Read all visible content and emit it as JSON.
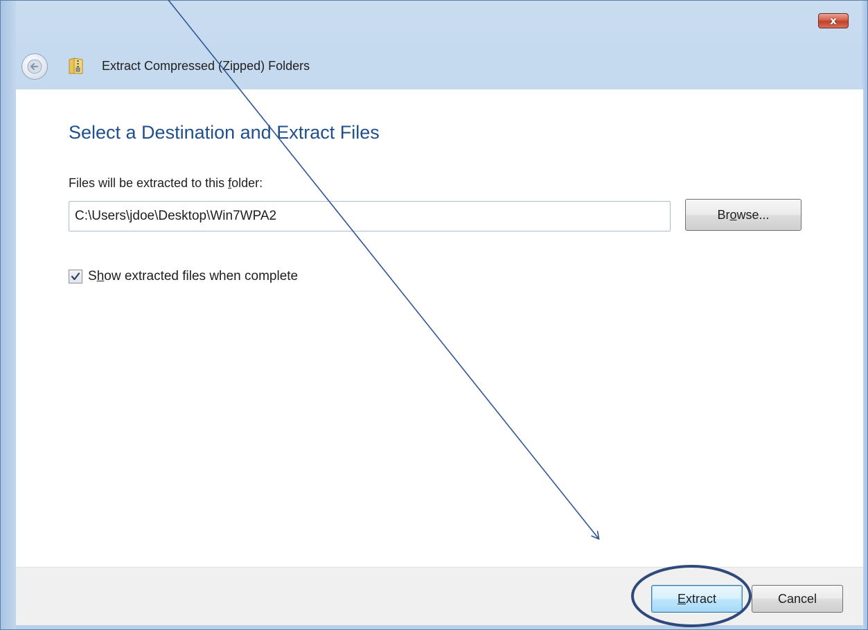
{
  "window": {
    "title": "Extract Compressed (Zipped) Folders",
    "close_glyph": "x"
  },
  "icons": {
    "back": "back-arrow-icon",
    "folder": "zipped-folder-icon",
    "check": "checkmark-icon"
  },
  "page": {
    "heading": "Select a Destination and Extract Files",
    "field_label": {
      "before": "Files will be extracted to this ",
      "mnemonic": "f",
      "after": "older:"
    },
    "path_value": "C:\\Users\\jdoe\\Desktop\\Win7WPA2",
    "browse": {
      "before": "Br",
      "mnemonic": "o",
      "after": "wse..."
    },
    "show_files": {
      "checked": true,
      "before": "S",
      "mnemonic": "h",
      "after": "ow extracted files when complete"
    }
  },
  "footer": {
    "extract": {
      "before": "",
      "mnemonic": "E",
      "after": "xtract"
    },
    "cancel": "Cancel"
  },
  "colors": {
    "heading": "#1f4f8c",
    "annotation": "#2f5597",
    "close_button": "#c2402a"
  }
}
